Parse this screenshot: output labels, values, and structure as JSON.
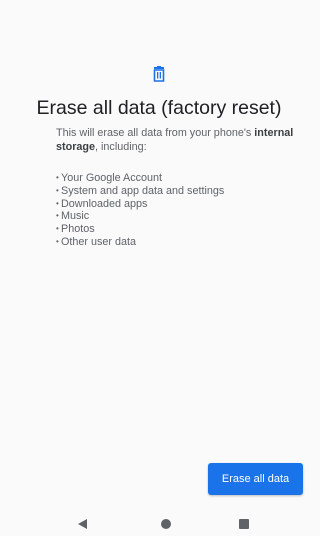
{
  "colors": {
    "accent": "#1a73e8",
    "background": "#fafafa",
    "title_text": "#202124",
    "body_text": "#5f6368",
    "nav_icons": "#5f6368"
  },
  "header": {
    "icon": "trash-icon",
    "title": "Erase all data (factory reset)"
  },
  "description": {
    "text_before": "This will erase all data from your phone's ",
    "bold": "internal storage",
    "text_after": ", including:"
  },
  "items": [
    {
      "label": "Your Google Account"
    },
    {
      "label": "System and app data and settings"
    },
    {
      "label": "Downloaded apps"
    },
    {
      "label": "Music"
    },
    {
      "label": "Photos"
    },
    {
      "label": "Other user data"
    }
  ],
  "actions": {
    "erase_label": "Erase all data"
  },
  "navbar": {
    "back_icon": "back-triangle-icon",
    "home_icon": "home-circle-icon",
    "recents_icon": "recents-square-icon"
  }
}
